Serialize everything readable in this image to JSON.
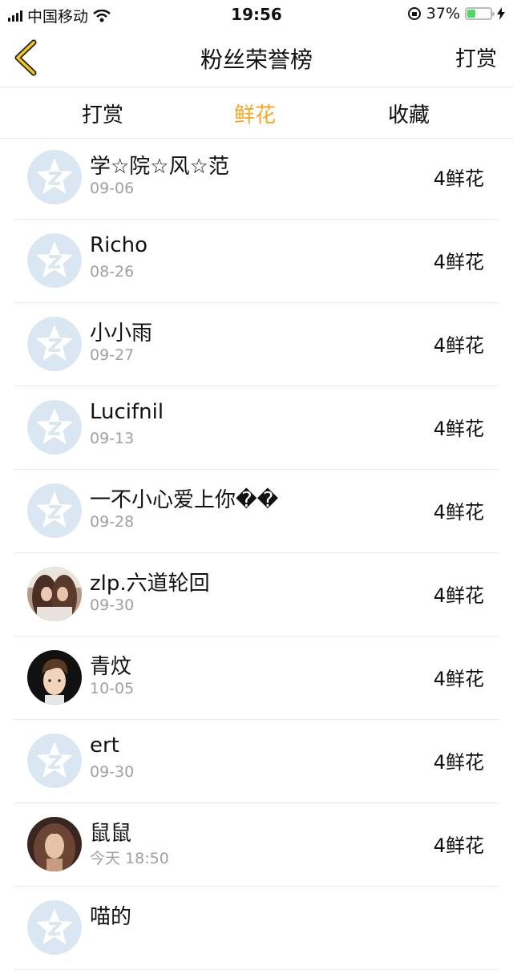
{
  "status": {
    "carrier": "中国移动",
    "time": "19:56",
    "battery": "37%",
    "battery_level": 0.37
  },
  "nav": {
    "title": "粉丝荣誉榜",
    "action": "打赏"
  },
  "tabs": [
    {
      "label": "打赏",
      "active": false
    },
    {
      "label": "鲜花",
      "active": true
    },
    {
      "label": "收藏",
      "active": false
    }
  ],
  "colors": {
    "accent": "#f5a623",
    "default_avatar": "#dbe6f3"
  },
  "rows": [
    {
      "name": "学☆院☆风☆范",
      "date": "09-06",
      "count": "4鲜花",
      "avatar": "default-avatar-icon"
    },
    {
      "name": "Richo",
      "date": "08-26",
      "count": "4鲜花",
      "avatar": "default-avatar-icon"
    },
    {
      "name": "小小雨",
      "date": "09-27",
      "count": "4鲜花",
      "avatar": "default-avatar-icon"
    },
    {
      "name": "Lucifnil",
      "date": "09-13",
      "count": "4鲜花",
      "avatar": "default-avatar-icon"
    },
    {
      "name": "一不小心爱上你��",
      "date": "09-28",
      "count": "4鲜花",
      "avatar": "default-avatar-icon"
    },
    {
      "name": "zlp.六道轮回",
      "date": "09-30",
      "count": "4鲜花",
      "avatar": "photo-avatar-two-girls"
    },
    {
      "name": "青炆",
      "date": "10-05",
      "count": "4鲜花",
      "avatar": "photo-avatar-cartoon-boy"
    },
    {
      "name": "ert",
      "date": "09-30",
      "count": "4鲜花",
      "avatar": "default-avatar-icon"
    },
    {
      "name": "鼠鼠",
      "date": "今天 18:50",
      "count": "4鲜花",
      "avatar": "photo-avatar-girl"
    },
    {
      "name": "喵的",
      "date": "",
      "count": "",
      "avatar": "default-avatar-icon"
    }
  ]
}
